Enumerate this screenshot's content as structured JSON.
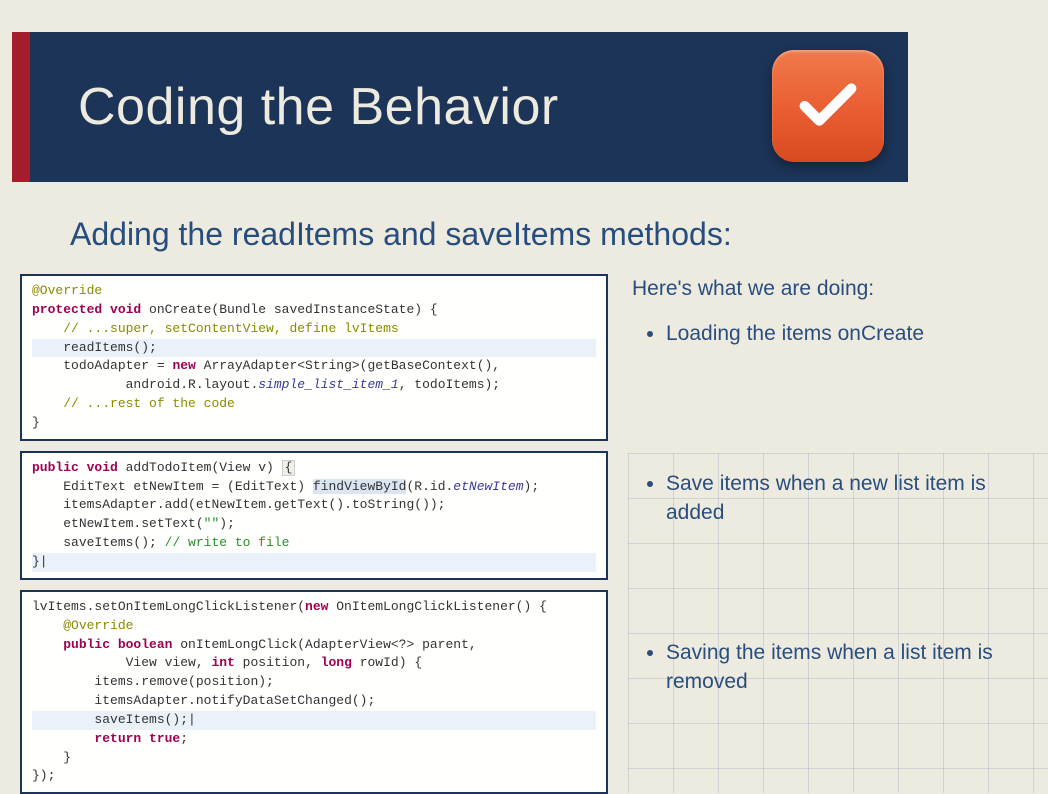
{
  "header": {
    "title": "Coding the Behavior"
  },
  "subtitle": "Adding the readItems and saveItems methods:",
  "explain": {
    "intro": "Here's what we are doing:",
    "bullets": [
      "Loading the items onCreate",
      "Save items when a new list item is added",
      "Saving the items when a list item is removed"
    ]
  },
  "code": {
    "block1": {
      "l1_ann": "@Override",
      "l2_kw1": "protected void",
      "l2_fn": " onCreate(Bundle savedInstanceState) {",
      "l3_cm": "// ...super, setContentView, define lvItems",
      "l4": "readItems();",
      "l5a": "todoAdapter = ",
      "l5_kw": "new",
      "l5b": " ArrayAdapter<String>(getBaseContext(),",
      "l6a": "android.R.layout.",
      "l6_id": "simple_list_item_1",
      "l6b": ", todoItems);",
      "l7_cm": "// ...rest of the code",
      "l8": "}"
    },
    "block2": {
      "l1_kw": "public void",
      "l1b": " addTodoItem(View v) ",
      "l1_brace": "{",
      "l2a": "EditText etNewItem = (EditText) ",
      "l2_box": "findViewById",
      "l2b": "(R.id.",
      "l2_id": "etNewItem",
      "l2c": ");",
      "l3": "itemsAdapter.add(etNewItem.getText().toString());",
      "l4a": "etNewItem.setText(",
      "l4_str": "\"\"",
      "l4b": ");",
      "l5a": "saveItems(); ",
      "l5_cm": "// write to file",
      "l6": "}|"
    },
    "block3": {
      "l1a": "lvItems.setOnItemLongClickListener(",
      "l1_kw": "new",
      "l1b": " OnItemLongClickListener() {",
      "l2_ann": "@Override",
      "l3_kw1": "public boolean",
      "l3b": " onItemLongClick(AdapterView<?> parent,",
      "l4a": "View view, ",
      "l4_kw": "int",
      "l4b": " position, ",
      "l4_kw2": "long",
      "l4c": " rowId) {",
      "l5": "items.remove(position);",
      "l6": "itemsAdapter.notifyDataSetChanged();",
      "l7": "saveItems();|",
      "l8_kw": "return true",
      "l8b": ";",
      "l9": "}",
      "l10": "});"
    }
  }
}
